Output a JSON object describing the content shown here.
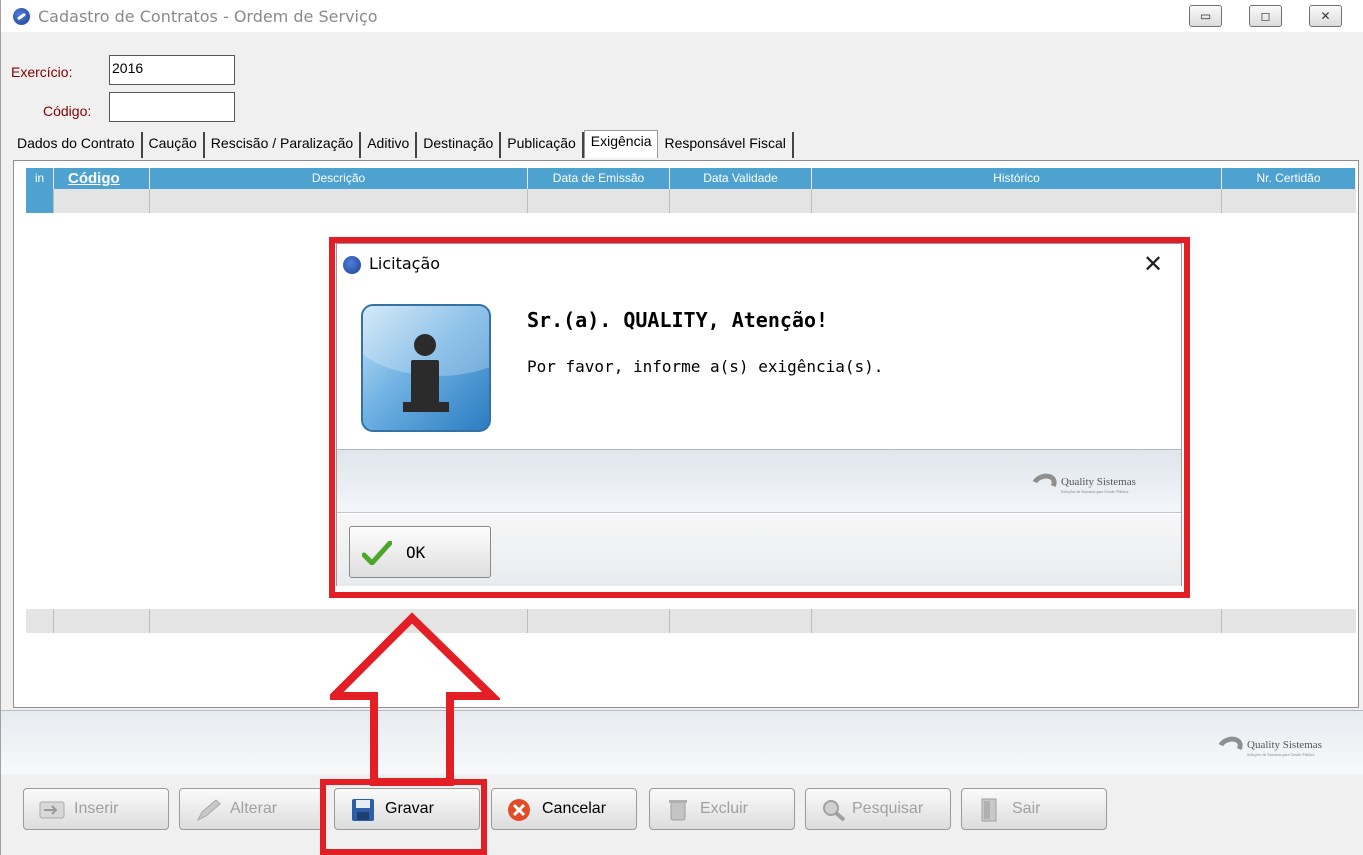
{
  "window": {
    "title": "Cadastro de Contratos  -  Ordem de Serviço",
    "controls": {
      "minimize": "▭",
      "maximize": "◻",
      "close": "✕"
    }
  },
  "header": {
    "exercicio_label": "Exercício:",
    "exercicio_value": "2016",
    "codigo_label": "Código:",
    "codigo_value": ""
  },
  "tabs": [
    {
      "label": "Dados do Contrato"
    },
    {
      "label": "Caução"
    },
    {
      "label": "Rescisão / Paralização"
    },
    {
      "label": "Aditivo"
    },
    {
      "label": "Destinação"
    },
    {
      "label": "Publicação"
    },
    {
      "label": "Exigência",
      "active": true
    },
    {
      "label": "Responsável Fiscal"
    }
  ],
  "grid": {
    "columns": [
      "in",
      "Código",
      "Descrição",
      "Data de Emissão",
      "Data Validade",
      "Histórico",
      "Nr. Certidão"
    ]
  },
  "brand": {
    "name": "Quality Sistemas",
    "tagline": "Soluções de Sistemas para Gestão Pública"
  },
  "buttons": [
    {
      "label": "Inserir",
      "enabled": false,
      "icon": "insert-icon"
    },
    {
      "label": "Alterar",
      "enabled": false,
      "icon": "pencil-icon"
    },
    {
      "label": "Gravar",
      "enabled": true,
      "icon": "save-icon"
    },
    {
      "label": "Cancelar",
      "enabled": true,
      "icon": "cancel-icon"
    },
    {
      "label": "Excluir",
      "enabled": false,
      "icon": "trash-icon"
    },
    {
      "label": "Pesquisar",
      "enabled": false,
      "icon": "search-icon"
    },
    {
      "label": "Sair",
      "enabled": false,
      "icon": "exit-door-icon"
    }
  ],
  "dialog": {
    "title": "Licitação",
    "close": "✕",
    "heading": "Sr.(a). QUALITY, Atenção!",
    "message": "Por favor, informe a(s) exigência(s).",
    "ok_label": "OK"
  },
  "colors": {
    "grid_header": "#4ea2d0",
    "annotation_red": "#e31e24",
    "label_maroon": "#800000"
  }
}
